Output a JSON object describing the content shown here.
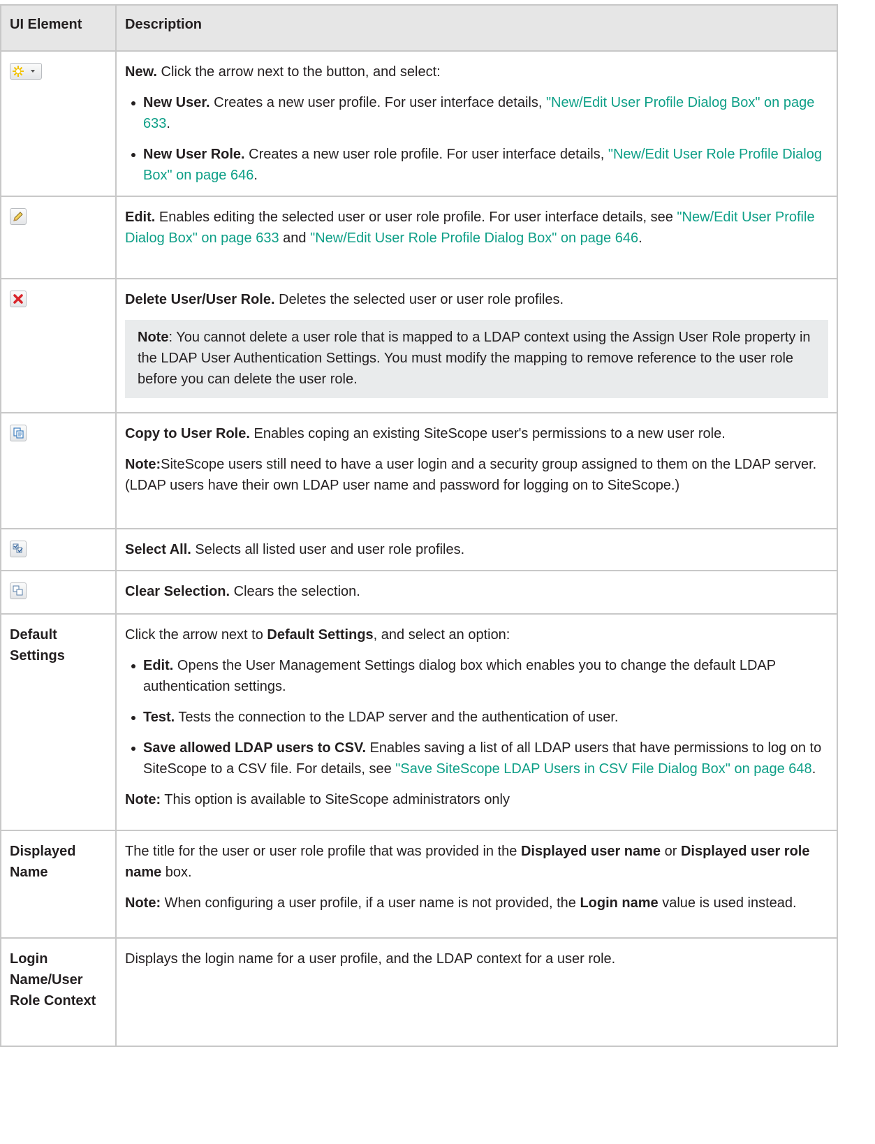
{
  "header": {
    "col1": "UI Element",
    "col2": "Description"
  },
  "rows": {
    "new": {
      "icon": "new-star-dropdown-icon",
      "title": "New.",
      "intro": " Click the arrow next to the button, and select:",
      "item1_title": "New User.",
      "item1_text": " Creates a new user profile. For user interface details, ",
      "item1_link": "\"New/Edit User Profile Dialog Box\" on page 633",
      "item2_title": "New User Role.",
      "item2_text": " Creates a new user role profile. For user interface details, ",
      "item2_link": "\"New/Edit User Role Profile Dialog Box\" on page 646"
    },
    "edit": {
      "icon": "pencil-icon",
      "title": "Edit.",
      "text": " Enables editing the selected user or user role profile. For user interface details, see ",
      "link1": "\"New/Edit User Profile Dialog Box\" on page 633",
      "and": " and ",
      "link2": "\"New/Edit User Role Profile Dialog Box\" on page 646"
    },
    "delete": {
      "icon": "delete-x-icon",
      "title": "Delete User/User Role.",
      "text": " Deletes the selected user or user role profiles.",
      "note_label": "Note",
      "note_text": ": You cannot delete a user role that is mapped to a LDAP context using the Assign User Role property in the LDAP User Authentication Settings. You must modify the mapping to remove reference to the user role before you can delete the user role."
    },
    "copy": {
      "icon": "copy-icon",
      "title": "Copy to User Role.",
      "text": " Enables coping an existing SiteScope user's permissions to a new user role.",
      "note_label": "Note:",
      "note_text": "SiteScope users still need to have a user login and a security group assigned to them on the LDAP server. (LDAP users have their own LDAP user name and password for logging on to SiteScope.)"
    },
    "select_all": {
      "icon": "select-all-icon",
      "title": "Select All.",
      "text": " Selects all listed user and user role profiles."
    },
    "clear": {
      "icon": "clear-selection-icon",
      "title": "Clear Selection.",
      "text": " Clears the selection."
    },
    "default_settings": {
      "element": "Default Settings",
      "intro_a": "Click the arrow next to ",
      "intro_b": "Default Settings",
      "intro_c": ", and select an option:",
      "item1_title": "Edit.",
      "item1_text": " Opens the User Management Settings dialog box which enables you to change the default LDAP authentication settings.",
      "item2_title": "Test.",
      "item2_text": " Tests the connection to the LDAP server and the authentication of user.",
      "item3_title": "Save allowed LDAP users to CSV.",
      "item3_text": " Enables saving a list of all LDAP users that have permissions to log on to SiteScope to a CSV file. For details, see ",
      "item3_link": "\"Save SiteScope LDAP Users in CSV File Dialog Box\" on page 648",
      "note_label": "Note:",
      "note_text": " This option is available to SiteScope administrators only"
    },
    "displayed_name": {
      "element": "Displayed Name",
      "text_a": "The title for the user or user role profile that was provided in the ",
      "text_b": "Displayed user name",
      "text_c": " or ",
      "text_d": "Displayed user role name",
      "text_e": " box.",
      "note_label": "Note:",
      "note_a": " When configuring a user profile, if a user name is not provided, the ",
      "note_b": "Login name",
      "note_c": " value is used instead."
    },
    "login_name": {
      "element": "Login Name/User Role Context",
      "text": "Displays the login name for a user profile, and the LDAP context for a user role."
    }
  }
}
